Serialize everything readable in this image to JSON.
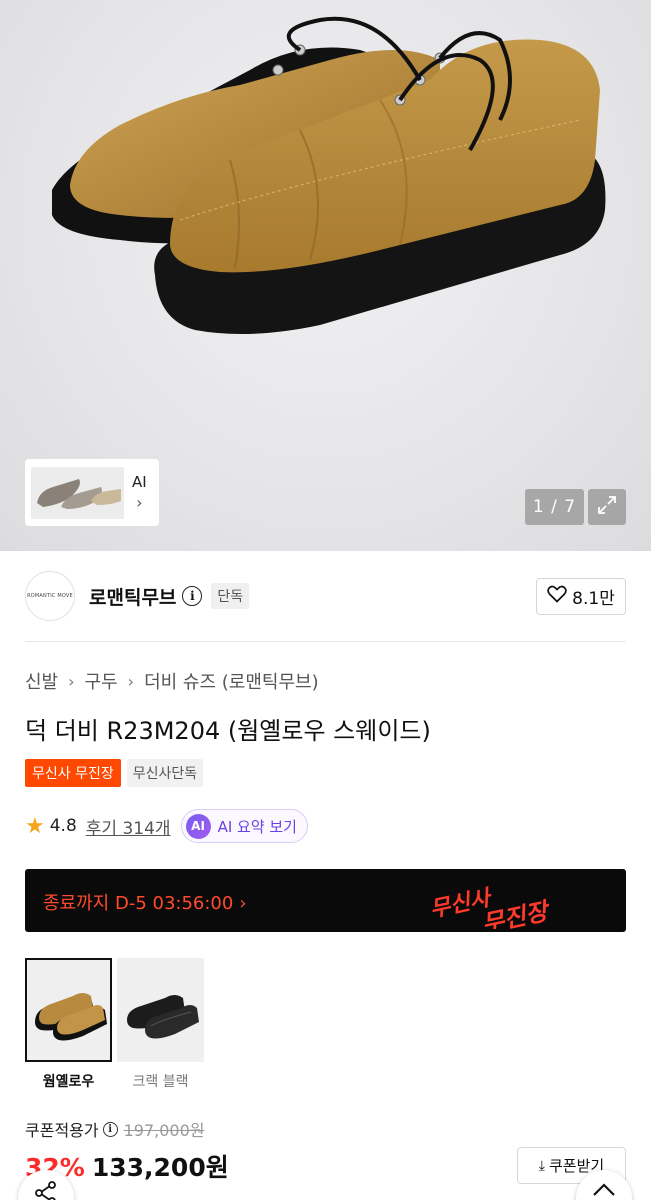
{
  "hero": {
    "thumb_label": "AI",
    "thumb_chevron": "›",
    "counter": "1 / 7",
    "expand_icon": "expand-icon"
  },
  "brand": {
    "logo_text": "ROMANTIC MOVE",
    "name": "로맨틱무브",
    "exclusive_badge": "단독",
    "likes": "8.1만"
  },
  "breadcrumb": [
    "신발",
    "구두",
    "더비 슈즈 (로맨틱무브)"
  ],
  "product": {
    "title": "덕 더비 R23M204 (웜옐로우 스웨이드)",
    "tags": [
      "무신사 무진장",
      "무신사단독"
    ]
  },
  "review": {
    "rating": "4.8",
    "review_text": "후기 314개",
    "ai_badge": "AI",
    "ai_summary": "AI 요약 보기"
  },
  "timer": {
    "text": "종료까지 D-5 03:56:00",
    "chevron": "›",
    "event_logo": "무신사 무진장",
    "colors": {
      "background": "#0a0a0a",
      "accent": "#ff4b2b"
    }
  },
  "options": [
    {
      "label": "웜옐로우",
      "selected": true
    },
    {
      "label": "크랙 블랙",
      "selected": false
    }
  ],
  "price": {
    "coupon_label": "쿠폰적용가",
    "original": "197,000원",
    "discount": "32%",
    "final": "133,200원",
    "coupon_button": "쿠폰받기"
  },
  "floating": {
    "share_icon": "share-icon",
    "top_icon": "chevron-up-icon"
  }
}
